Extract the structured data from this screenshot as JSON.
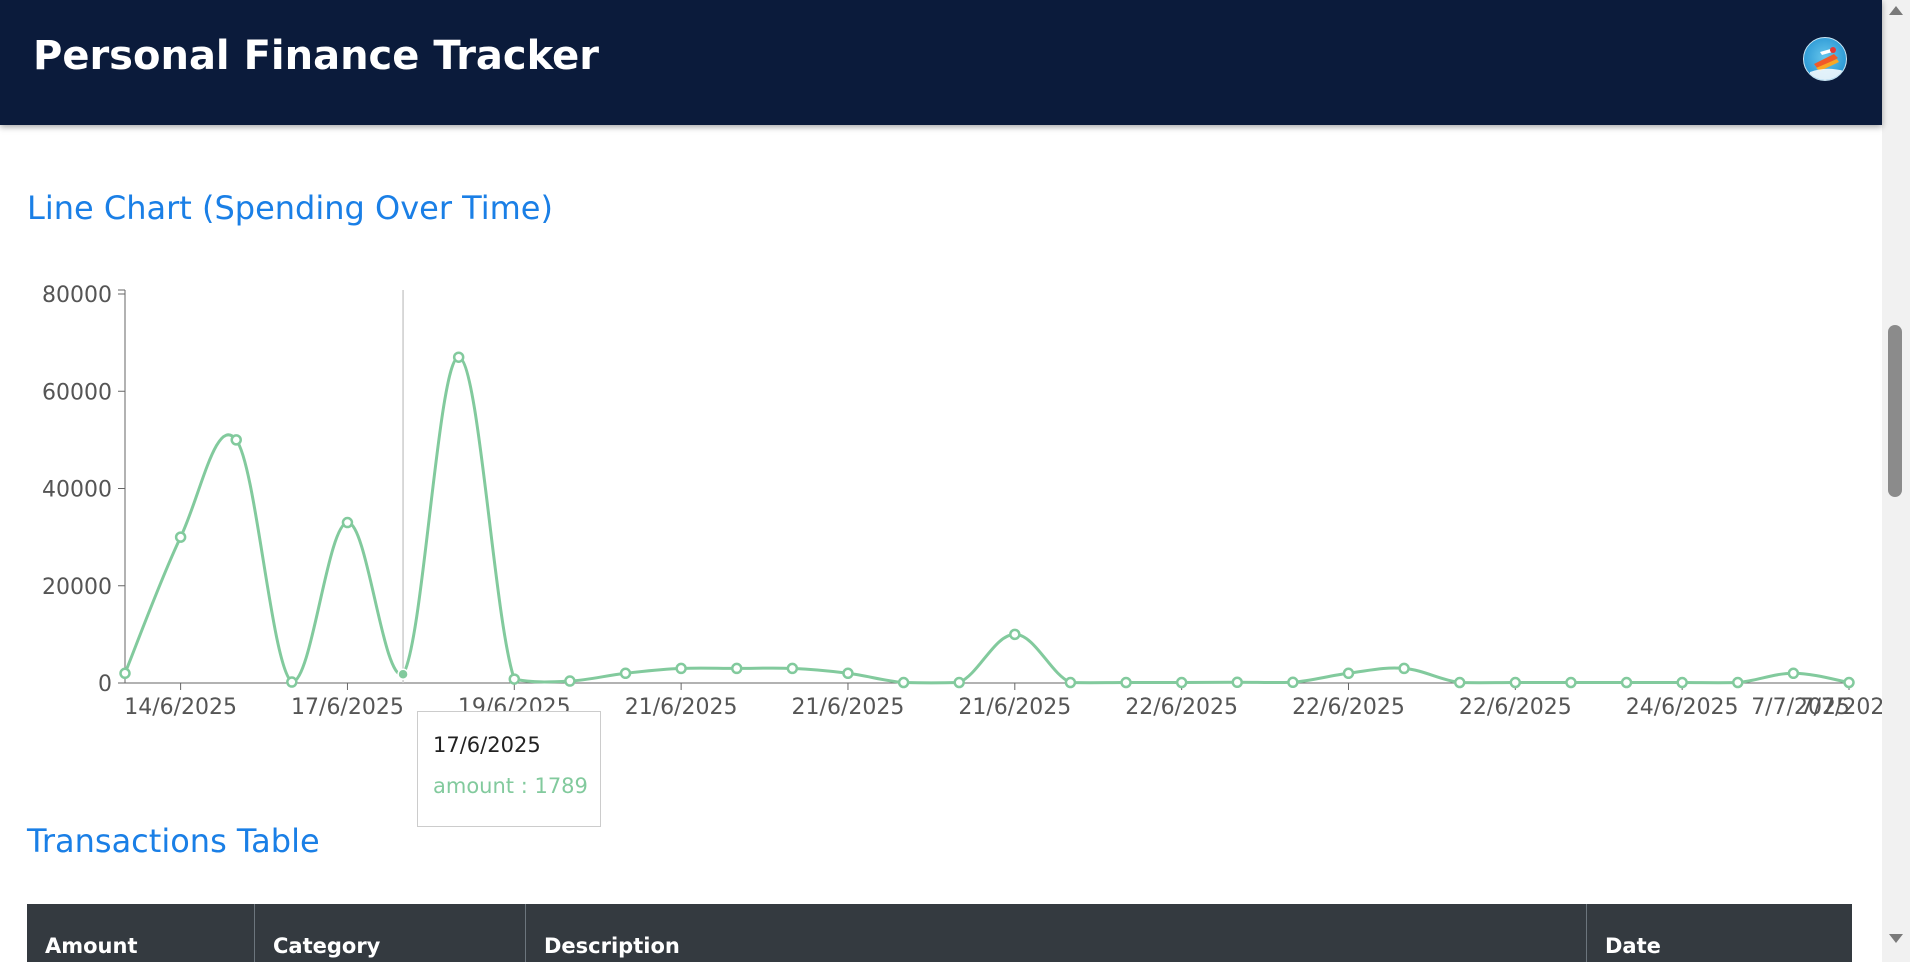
{
  "header": {
    "title": "Personal Finance Tracker"
  },
  "line_section": {
    "title": "Line Chart (Spending Over Time)"
  },
  "table_section": {
    "title": "Transactions Table",
    "columns": [
      "Amount",
      "Category",
      "Description",
      "Date"
    ]
  },
  "tooltip": {
    "label": "17/6/2025",
    "series_name": "amount",
    "value": 1789,
    "text": "amount : 1789"
  },
  "colors": {
    "header_bg": "#0b1b3b",
    "accent": "#1a7fe6",
    "series": "#82ca9d",
    "table_head": "#343a40"
  },
  "chart_data": {
    "type": "line",
    "x": [
      "14/6/2025",
      "14/6/2025",
      "14/6/2025",
      "17/6/2025",
      "17/6/2025",
      "17/6/2025",
      "17/6/2025",
      "19/6/2025",
      "19/6/2025",
      "21/6/2025",
      "21/6/2025",
      "21/6/2025",
      "21/6/2025",
      "21/6/2025",
      "21/6/2025",
      "21/6/2025",
      "21/6/2025",
      "21/6/2025",
      "22/6/2025",
      "22/6/2025",
      "22/6/2025",
      "22/6/2025",
      "22/6/2025",
      "22/6/2025",
      "22/6/2025",
      "22/6/2025",
      "22/6/2025",
      "22/6/2025",
      "24/6/2025",
      "24/6/2025",
      "24/6/2025",
      "7/7/2025"
    ],
    "series": [
      {
        "name": "amount",
        "values": [
          2000,
          30000,
          50000,
          200,
          33000,
          1789,
          67000,
          800,
          400,
          2000,
          3000,
          3000,
          3000,
          2000,
          100,
          100,
          10000,
          100,
          100,
          100,
          150,
          150,
          2000,
          3000,
          100,
          100,
          100,
          100,
          100,
          100,
          2000,
          100
        ]
      }
    ],
    "x_tick_labels": [
      "14/6/2025",
      "17/6/2025",
      "19/6/2025",
      "21/6/2025",
      "21/6/2025",
      "21/6/2025",
      "22/6/2025",
      "22/6/2025",
      "22/6/2025",
      "24/6/2025",
      "7/7/2025"
    ],
    "y_ticks": [
      0,
      20000,
      40000,
      60000,
      80000
    ],
    "ylim": [
      0,
      80000
    ],
    "title": "Line Chart (Spending Over Time)",
    "xlabel": "",
    "ylabel": "",
    "grid": false,
    "legend": "none",
    "highlight_index": 5
  }
}
